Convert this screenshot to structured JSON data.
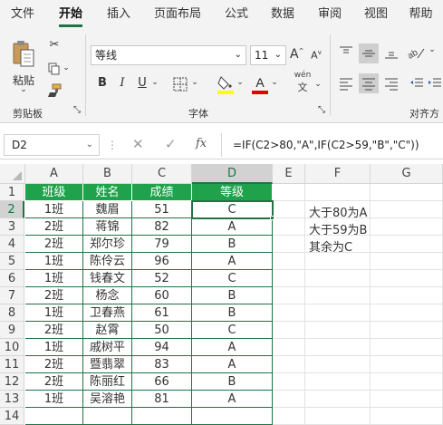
{
  "menu": {
    "tabs": [
      "文件",
      "开始",
      "插入",
      "页面布局",
      "公式",
      "数据",
      "审阅",
      "视图",
      "帮助"
    ],
    "active": "开始"
  },
  "ribbon": {
    "clipboard": {
      "paste_label": "粘贴",
      "group_label": "剪贴板"
    },
    "font": {
      "family": "等线",
      "size": "11",
      "group_label": "字体",
      "bold": "B",
      "italic": "I",
      "underline": "U",
      "grow": "A",
      "shrink": "A",
      "phonetic": "wén"
    },
    "align": {
      "group_label": "对齐方"
    },
    "colors": {
      "fill": "#FFFF00",
      "font": "#E00000",
      "accent": "#217346"
    }
  },
  "formula_bar": {
    "name_box": "D2",
    "formula": "=IF(C2>80,\"A\",IF(C2>59,\"B\",\"C\"))",
    "fx": "fx"
  },
  "sheet": {
    "columns": [
      "A",
      "B",
      "C",
      "D",
      "E",
      "F",
      "G"
    ],
    "rows": [
      "1",
      "2",
      "3",
      "4",
      "5",
      "6",
      "7",
      "8",
      "9",
      "10",
      "11",
      "12",
      "13",
      "14"
    ],
    "selected_cell": "D2",
    "header": [
      "班级",
      "姓名",
      "成绩",
      "等级"
    ],
    "data": [
      [
        "1班",
        "魏眉",
        "51",
        "C"
      ],
      [
        "2班",
        "蒋锦",
        "82",
        "A"
      ],
      [
        "2班",
        "郑尔珍",
        "79",
        "B"
      ],
      [
        "1班",
        "陈伶云",
        "96",
        "A"
      ],
      [
        "1班",
        "钱春文",
        "52",
        "C"
      ],
      [
        "2班",
        "杨念",
        "60",
        "B"
      ],
      [
        "1班",
        "卫春燕",
        "61",
        "B"
      ],
      [
        "2班",
        "赵霄",
        "50",
        "C"
      ],
      [
        "1班",
        "戚树平",
        "94",
        "A"
      ],
      [
        "2班",
        "暨翡翠",
        "83",
        "A"
      ],
      [
        "2班",
        "陈丽红",
        "66",
        "B"
      ],
      [
        "1班",
        "吴溶艳",
        "81",
        "A"
      ]
    ],
    "notes": [
      "大于80为A",
      "大于59为B",
      "其余为C"
    ]
  }
}
